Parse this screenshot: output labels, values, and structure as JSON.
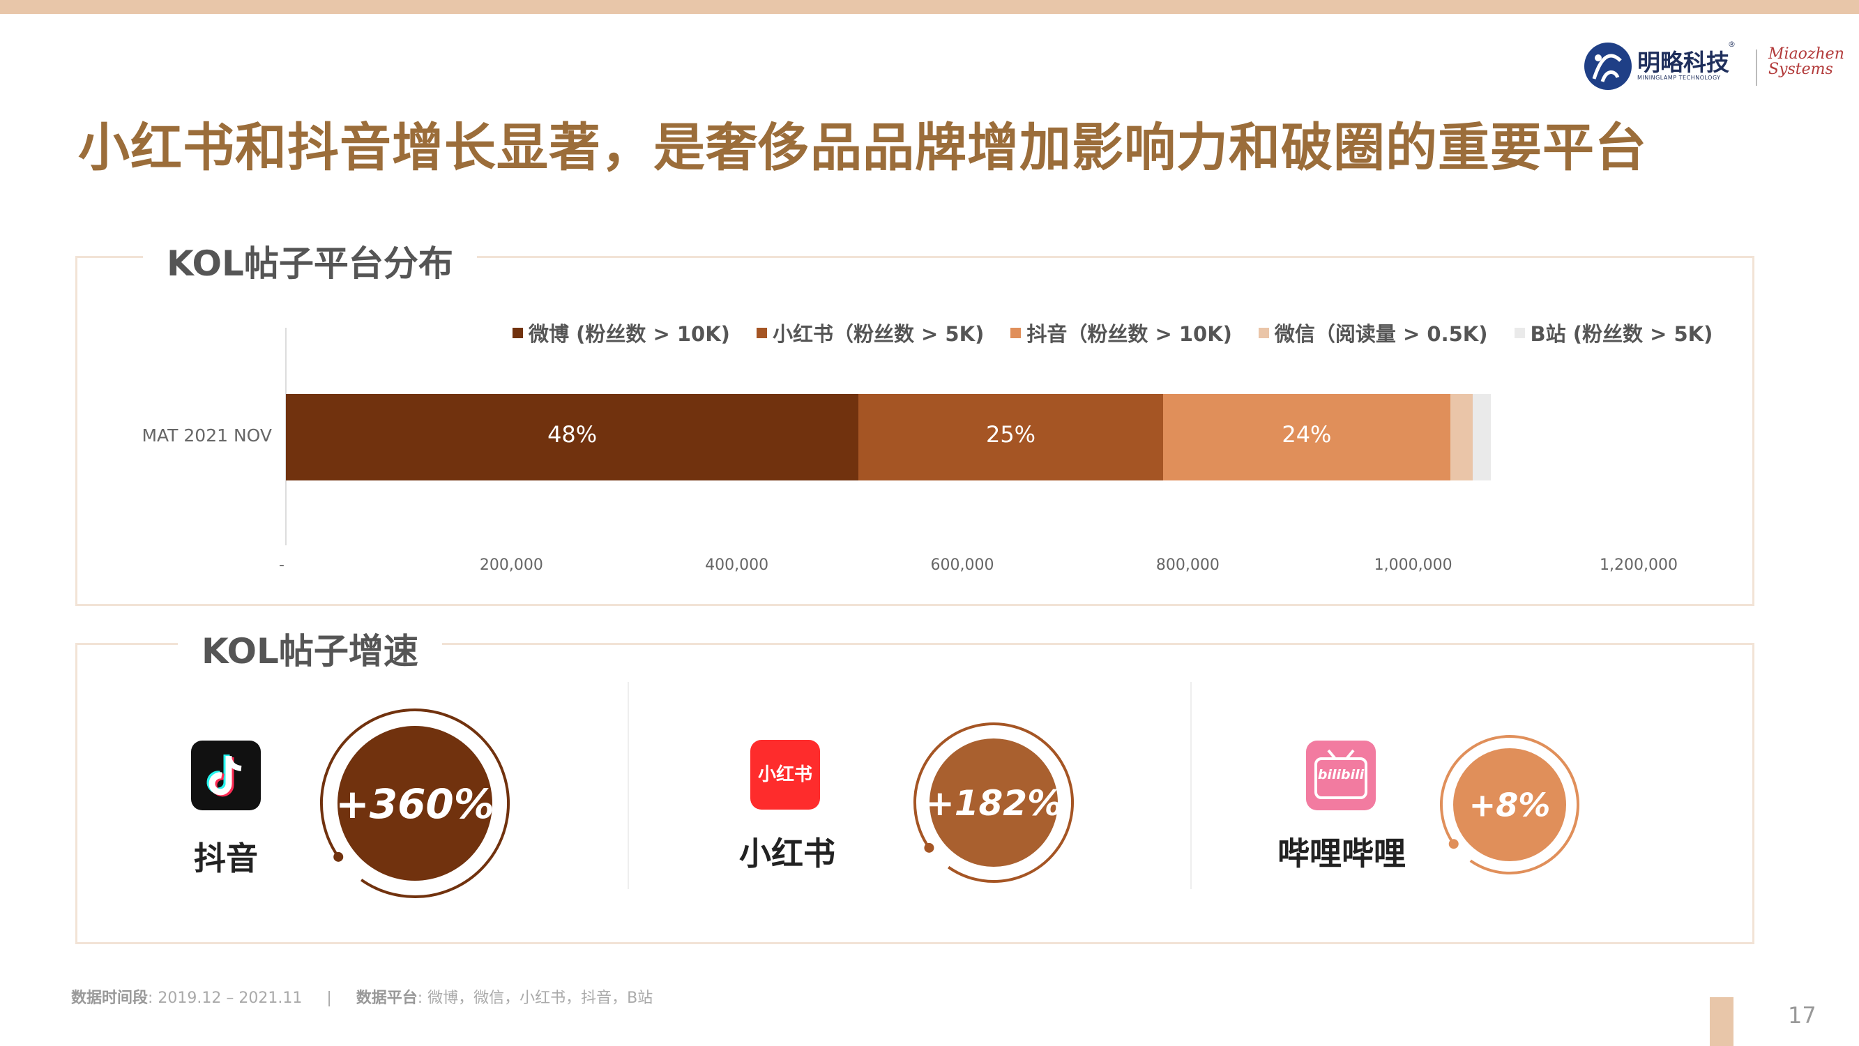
{
  "header": {
    "title": "小红书和抖音增长显著，是奢侈品品牌增加影响力和破圈的重要平台",
    "logo_cn": "明略科技",
    "logo_reg": "®",
    "logo_en": "MININGLAMP TECHNOLOGY",
    "logo_mz_line1": "Miaozhen",
    "logo_mz_line2": "Systems"
  },
  "distribution": {
    "section_label": "KOL帖子平台分布"
  },
  "chart_data": {
    "type": "bar",
    "orientation": "horizontal",
    "stacked": true,
    "categories": [
      "MAT 2021 NOV"
    ],
    "series": [
      {
        "name": "微博 (粉丝数 > 10K)",
        "values": [
          508000
        ],
        "label": "48%",
        "color": "#71320e"
      },
      {
        "name": "小红书（粉丝数 > 5K)",
        "values": [
          270000
        ],
        "label": "25%",
        "color": "#a55524"
      },
      {
        "name": "抖音（粉丝数 > 10K)",
        "values": [
          255000
        ],
        "label": "24%",
        "color": "#e08f5a"
      },
      {
        "name": "微信（阅读量 > 0.5K)",
        "values": [
          20000
        ],
        "label": "",
        "color": "#eac5a8"
      },
      {
        "name": "B站 (粉丝数 > 5K)",
        "values": [
          16000
        ],
        "label": "",
        "color": "#eaeaea"
      }
    ],
    "xlim": [
      0,
      1200000
    ],
    "xticks": [
      "-",
      "200,000",
      "400,000",
      "600,000",
      "800,000",
      "1,000,000",
      "1,200,000"
    ],
    "grid": false,
    "legend_position": "top"
  },
  "growth": {
    "section_label": "KOL帖子增速",
    "items": [
      {
        "name": "抖音",
        "value_text": "+360%",
        "color": "#71320e",
        "ring_color": "#71320e"
      },
      {
        "name": "小红书",
        "value_text": "+182%",
        "color": "#a9602f",
        "ring_color": "#a55524"
      },
      {
        "name": "哔哩哔哩",
        "value_text": "+8%",
        "color": "#e08f5a",
        "ring_color": "#e08f5a"
      }
    ],
    "xhs_icon_text": "小红书",
    "bili_icon_text": "bilibili"
  },
  "footer": {
    "period_label": "数据时间段",
    "period_value": ": 2019.12 – 2021.11",
    "separator": "|",
    "platform_label": "数据平台",
    "platform_value": ": 微博，微信，小红书，抖音，B站",
    "page_number": "17"
  }
}
